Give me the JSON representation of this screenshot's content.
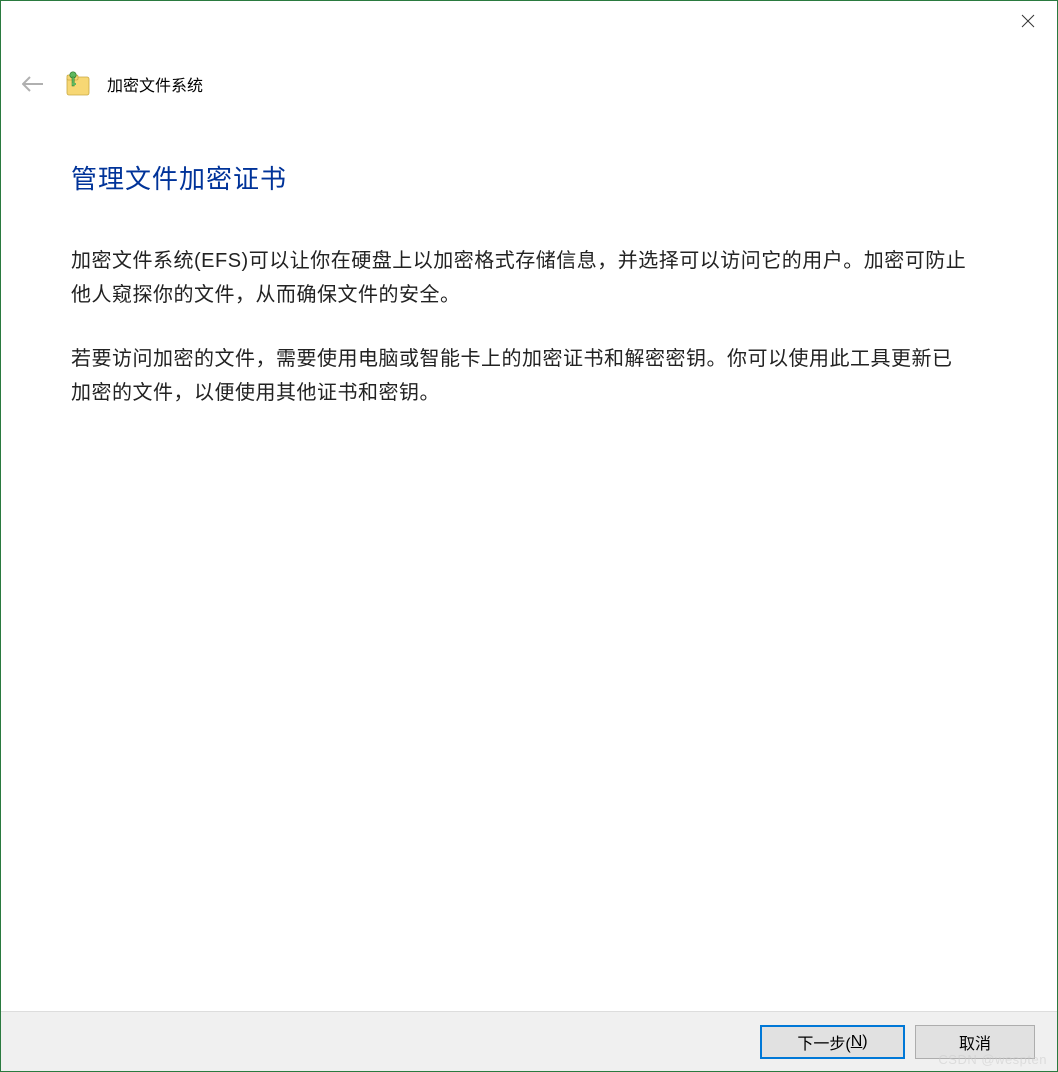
{
  "titlebar": {
    "close_icon": "close"
  },
  "header": {
    "back_icon": "back-arrow",
    "app_icon": "efs-folder-key",
    "app_title": "加密文件系统"
  },
  "content": {
    "heading": "管理文件加密证书",
    "paragraph1": "加密文件系统(EFS)可以让你在硬盘上以加密格式存储信息，并选择可以访问它的用户。加密可防止他人窥探你的文件，从而确保文件的安全。",
    "paragraph2": "若要访问加密的文件，需要使用电脑或智能卡上的加密证书和解密密钥。你可以使用此工具更新已加密的文件，以便使用其他证书和密钥。"
  },
  "footer": {
    "next_prefix": "下一步(",
    "next_accel": "N",
    "next_suffix": ")",
    "cancel_label": "取消"
  },
  "watermark": "CSDN @wespten"
}
